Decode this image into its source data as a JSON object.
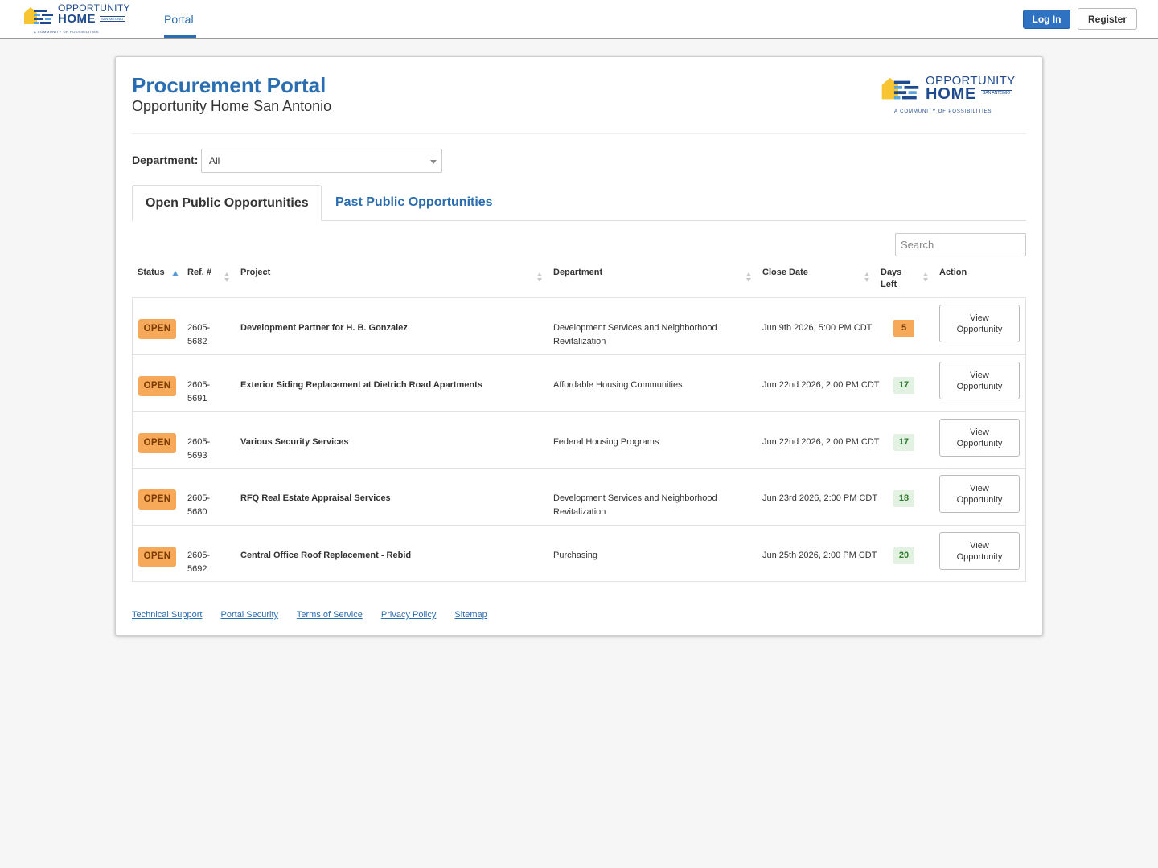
{
  "brand": {
    "name": "OPPORTUNITY",
    "home": "HOME",
    "city": "SAN ANTONIO",
    "tagline": "A COMMUNITY OF POSSIBILITIES",
    "colors": {
      "blue": "#1f4b8e",
      "yellow": "#f7c531",
      "lightblue": "#5aa6df"
    }
  },
  "nav": {
    "portal_label": "Portal",
    "login_label": "Log In",
    "register_label": "Register"
  },
  "page": {
    "title": "Procurement Portal",
    "subtitle": "Opportunity Home San Antonio"
  },
  "filter": {
    "department_label": "Department:",
    "department_value": "All"
  },
  "tabs": {
    "open": "Open Public Opportunities",
    "past": "Past Public Opportunities"
  },
  "search": {
    "placeholder": "Search"
  },
  "table": {
    "headers": {
      "status": "Status",
      "ref": "Ref. #",
      "project": "Project",
      "department": "Department",
      "close_date": "Close Date",
      "days_left": "Days Left",
      "action": "Action"
    },
    "rows": [
      {
        "status": "OPEN",
        "ref": "2605-5682",
        "project": "Development Partner for H. B. Gonzalez",
        "department": "Development Services and Neighborhood Revitalization",
        "close_date": "Jun 9th 2026, 5:00 PM CDT",
        "days_left": "5",
        "action": "View Opportunity"
      },
      {
        "status": "OPEN",
        "ref": "2605-5691",
        "project": "Exterior Siding Replacement at Dietrich Road Apartments",
        "department": "Affordable Housing Communities",
        "close_date": "Jun 22nd 2026, 2:00 PM CDT",
        "days_left": "17",
        "action": "View Opportunity"
      },
      {
        "status": "OPEN",
        "ref": "2605-5693",
        "project": "Various Security Services",
        "department": "Federal Housing Programs",
        "close_date": "Jun 22nd 2026, 2:00 PM CDT",
        "days_left": "17",
        "action": "View Opportunity"
      },
      {
        "status": "OPEN",
        "ref": "2605-5680",
        "project": "RFQ Real Estate Appraisal Services",
        "department": "Development Services and Neighborhood Revitalization",
        "close_date": "Jun 23rd 2026, 2:00 PM CDT",
        "days_left": "18",
        "action": "View Opportunity"
      },
      {
        "status": "OPEN",
        "ref": "2605-5692",
        "project": "Central Office Roof Replacement - Rebid",
        "department": "Purchasing",
        "close_date": "Jun 25th 2026, 2:00 PM CDT",
        "days_left": "20",
        "action": "View Opportunity"
      }
    ]
  },
  "footer": {
    "links": [
      "Technical Support",
      "Portal Security",
      "Terms of Service",
      "Privacy Policy",
      "Sitemap"
    ]
  },
  "colors": {
    "accent": "#2a6db0",
    "open_badge": "#f7a95a",
    "days_ok_bg": "#e3f1e3",
    "days_ok_text": "#2b7a2b"
  }
}
